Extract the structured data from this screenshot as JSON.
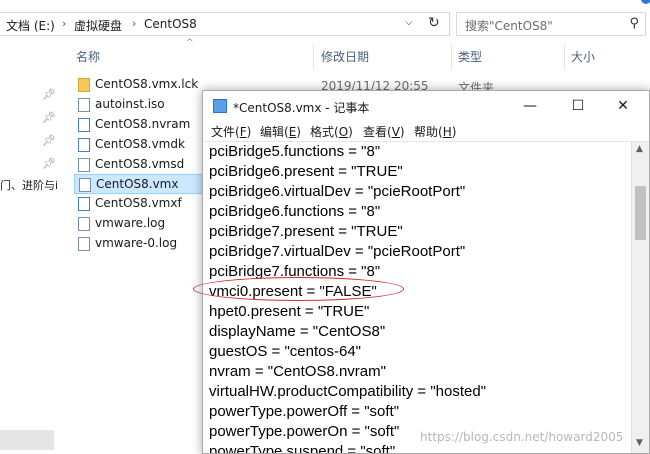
{
  "address": {
    "crumbs": [
      "文档 (E:)",
      "虚拟硬盘",
      "CentOS8"
    ],
    "separator": "›",
    "dropdown_icon": "chevron-down-icon",
    "refresh_icon": "refresh-icon"
  },
  "search": {
    "placeholder": "搜索\"CentOS8\""
  },
  "nav": {
    "truncated_label": "门、进阶与i"
  },
  "columns": {
    "name": "名称",
    "modified": "修改日期",
    "type": "类型",
    "size": "大小"
  },
  "files": [
    {
      "name": "CentOS8.vmx.lck",
      "icon": "folder-icon"
    },
    {
      "name": "autoinst.iso",
      "icon": "disc-file-icon"
    },
    {
      "name": "CentOS8.nvram",
      "icon": "file-icon"
    },
    {
      "name": "CentOS8.vmdk",
      "icon": "disk-file-icon"
    },
    {
      "name": "CentOS8.vmsd",
      "icon": "file-icon"
    },
    {
      "name": "CentOS8.vmx",
      "icon": "vm-file-icon",
      "selected": true
    },
    {
      "name": "CentOS8.vmxf",
      "icon": "file-icon"
    },
    {
      "name": "vmware.log",
      "icon": "text-file-icon"
    },
    {
      "name": "vmware-0.log",
      "icon": "text-file-icon"
    }
  ],
  "first_row_meta": {
    "modified": "2019/11/12 20:55",
    "type": "文件夹"
  },
  "notepad": {
    "title": "*CentOS8.vmx - 记事本",
    "buttons": {
      "minimize": "—",
      "maximize": "☐",
      "close": "✕"
    },
    "menu": [
      {
        "label": "文件",
        "key": "F"
      },
      {
        "label": "编辑",
        "key": "E"
      },
      {
        "label": "格式",
        "key": "O"
      },
      {
        "label": "查看",
        "key": "V"
      },
      {
        "label": "帮助",
        "key": "H"
      }
    ],
    "lines": [
      "pciBridge5.functions = \"8\"",
      "pciBridge6.present = \"TRUE\"",
      "pciBridge6.virtualDev = \"pcieRootPort\"",
      "pciBridge6.functions = \"8\"",
      "pciBridge7.present = \"TRUE\"",
      "pciBridge7.virtualDev = \"pcieRootPort\"",
      "pciBridge7.functions = \"8\"",
      "vmci0.present = \"FALSE\"",
      "hpet0.present = \"TRUE\"",
      "displayName = \"CentOS8\"",
      "guestOS = \"centos-64\"",
      "nvram = \"CentOS8.nvram\"",
      "virtualHW.productCompatibility = \"hosted\"",
      "powerType.powerOff = \"soft\"",
      "powerType.powerOn = \"soft\"",
      "powerType.suspend = \"soft\""
    ],
    "highlighted_line": "vmci0.present = \"FALSE\"",
    "highlight_color": "#d6282f"
  },
  "watermark": "https://blog.csdn.net/howard2005"
}
